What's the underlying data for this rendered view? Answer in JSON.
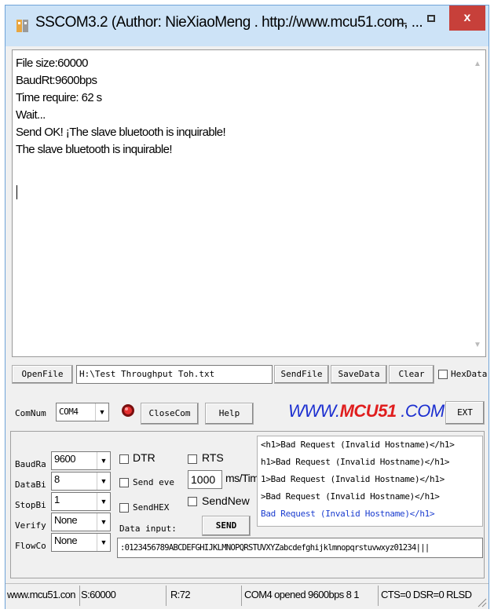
{
  "window": {
    "title": "SSCOM3.2 (Author: NieXiaoMeng . http://www.mcu51.com, ...",
    "minimize": "–",
    "close": "x"
  },
  "receive": {
    "lines": "File size:60000\nBaudRt:9600bps\nTime require: 62 s\nWait...\nSend OK! ¡The slave bluetooth is inquirable!\nThe slave bluetooth is inquirable!"
  },
  "file_row": {
    "open_file": "OpenFile",
    "file_path": "H:\\Test Throughput Toh.txt",
    "send_file": "SendFile",
    "save_data": "SaveData",
    "clear": "Clear",
    "hex_data": "HexData"
  },
  "port_row": {
    "comnum_label": "ComNum",
    "com_value": "COM4",
    "close_com": "CloseCom",
    "help": "Help",
    "banner": "WWW.MCU51.COM",
    "banner_prefix": "WWW.",
    "banner_brand": "MCU51",
    "banner_suffix": " .COM",
    "ext": "EXT"
  },
  "settings": {
    "baudrate_label": "BaudRa",
    "baudrate_value": "9600",
    "databits_label": "DataBi",
    "databits_value": "8",
    "stopbits_label": "StopBi",
    "stopbits_value": "1",
    "verify_label": "Verify",
    "verify_value": "None",
    "flowcon_label": "FlowCo",
    "flowcon_value": "None"
  },
  "options": {
    "dtr": "DTR",
    "rts": "RTS",
    "send_every": "Send eve",
    "interval_value": "1000",
    "interval_unit": "ms/Time",
    "send_hex": "SendHEX",
    "send_new": "SendNew",
    "data_input_label": "Data input:",
    "send_button": "SEND"
  },
  "history": [
    "<h1>Bad Request (Invalid Hostname)</h1>",
    "h1>Bad Request (Invalid Hostname)</h1>",
    "1>Bad Request (Invalid Hostname)</h1>",
    ">Bad Request (Invalid Hostname)</h1>",
    "Bad Request (Invalid Hostname)</h1>"
  ],
  "data_input_value": ":0123456789ABCDEFGHIJKLMNOPQRSTUVXYZabcdefghijklmnopqrstuvwxyz01234|||",
  "status": {
    "site": "www.mcu51.con",
    "sent": "S:60000",
    "received": "R:72",
    "port_state": "COM4 opened 9600bps 8 1",
    "lines_state": "CTS=0 DSR=0 RLSD"
  },
  "colors": {
    "title_bar": "#cde3f7",
    "close_button": "#c7403a",
    "banner_blue": "#1c2fd0",
    "banner_red": "#e01e1e",
    "history_selected": "#1a3ccf"
  }
}
